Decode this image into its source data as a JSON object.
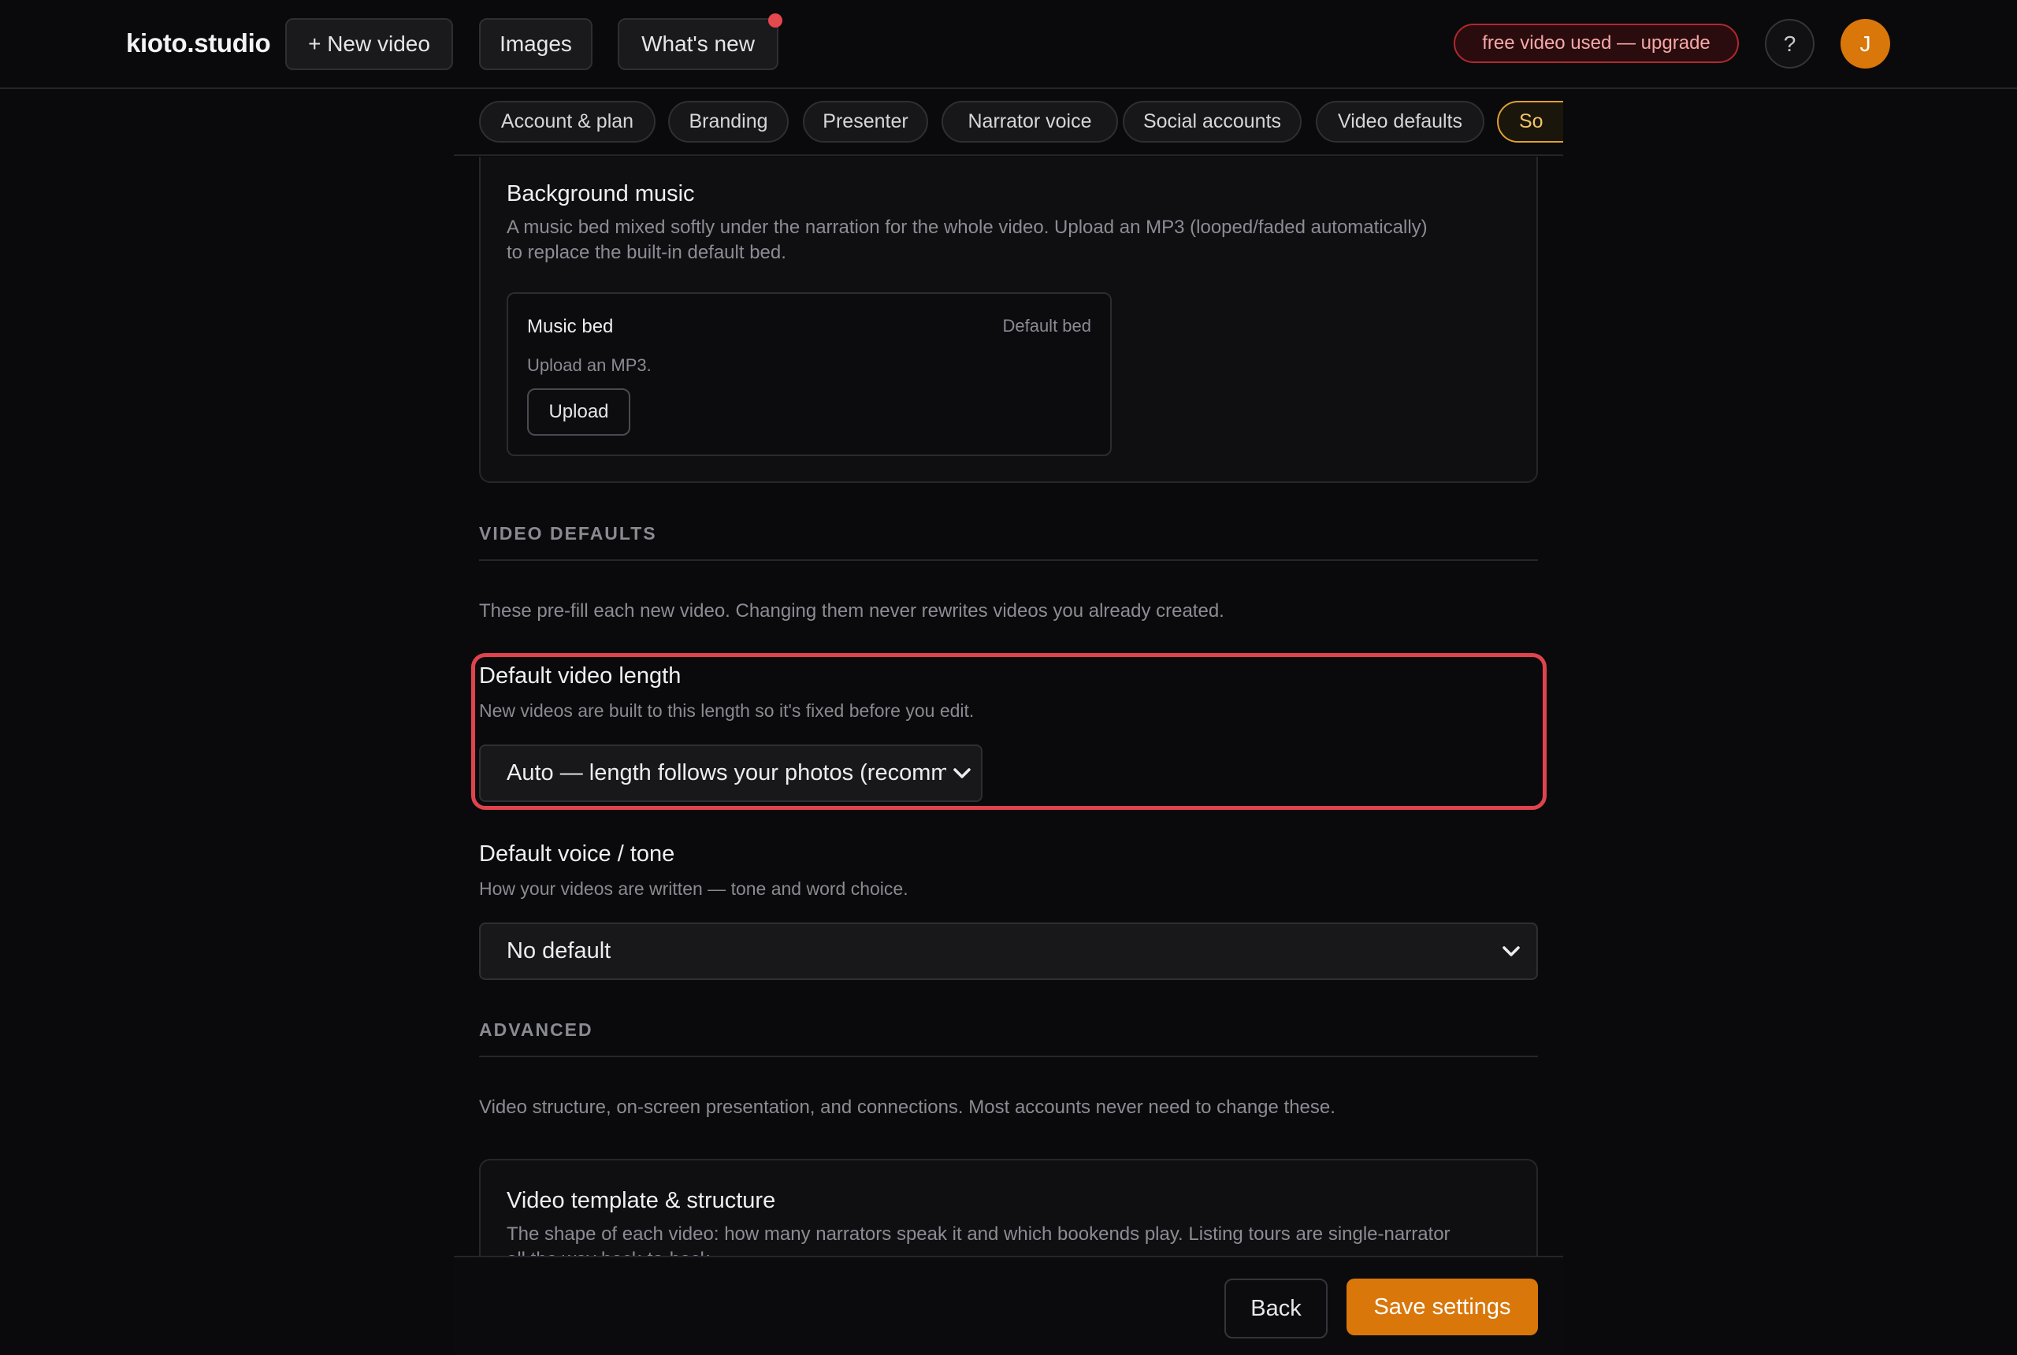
{
  "topbar": {
    "brand": "kioto.studio",
    "new_video": "+ New video",
    "images": "Images",
    "whats_new": "What's new",
    "upgrade_pill": "free video used — upgrade",
    "help": "?",
    "avatar_initial": "J"
  },
  "tabs": [
    {
      "label": "Account & plan"
    },
    {
      "label": "Branding"
    },
    {
      "label": "Presenter"
    },
    {
      "label": "Narrator voice"
    },
    {
      "label": "Social accounts"
    },
    {
      "label": "Video defaults"
    },
    {
      "label": "So"
    }
  ],
  "music": {
    "title": "Background music",
    "desc_line1": "A music bed mixed softly under the narration for the whole video. Upload an MP3 (looped/faded automatically)",
    "desc_line2": "to replace the built-in default bed.",
    "bed_title": "Music bed",
    "bed_status": "Default bed",
    "bed_desc": "Upload an MP3.",
    "upload_label": "Upload"
  },
  "video_defaults": {
    "heading": "VIDEO DEFAULTS",
    "desc": "These pre-fill each new video. Changing them never rewrites videos you already created.",
    "length_title": "Default video length",
    "length_desc": "New videos are built to this length so it's fixed before you edit.",
    "length_value": "Auto — length follows your photos (recommended)",
    "voice_title": "Default voice / tone",
    "voice_desc": "How your videos are written — tone and word choice.",
    "voice_value": "No default"
  },
  "advanced": {
    "heading": "ADVANCED",
    "desc": "Video structure, on-screen presentation, and connections. Most accounts never need to change these.",
    "template_title": "Video template & structure",
    "template_desc_line1": "The shape of each video: how many narrators speak it and which bookends play. Listing tours are single-narrator",
    "template_desc_line2": "all the way back-to-back."
  },
  "footer": {
    "back": "Back",
    "save": "Save settings"
  },
  "colors": {
    "accent": "#d9770b",
    "highlight": "#e0434d",
    "upgrade_text": "#f7a8a8",
    "background": "#0a0a0c"
  }
}
